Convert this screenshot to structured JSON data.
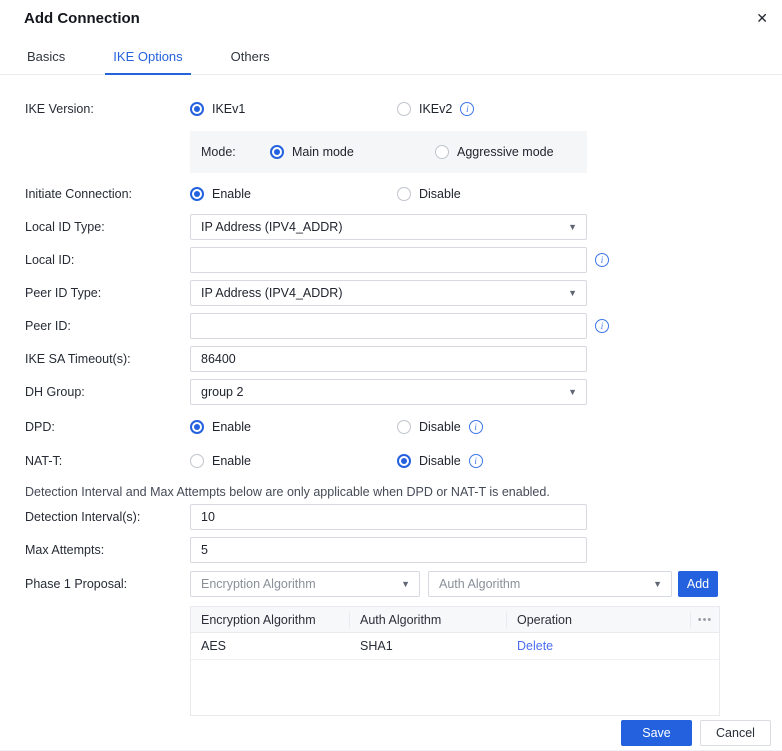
{
  "header": {
    "title": "Add Connection",
    "close_icon": "✕"
  },
  "tabs": {
    "basics": "Basics",
    "ike_options": "IKE Options",
    "others": "Others"
  },
  "rows": {
    "ike_version": {
      "label": "IKE Version:",
      "opt1": "IKEv1",
      "opt2": "IKEv2"
    },
    "mode": {
      "label": "Mode:",
      "opt1": "Main mode",
      "opt2": "Aggressive mode"
    },
    "initiate_connection": {
      "label": "Initiate Connection:",
      "opt1": "Enable",
      "opt2": "Disable"
    },
    "local_id_type": {
      "label": "Local ID Type:",
      "value": "IP Address (IPV4_ADDR)"
    },
    "local_id": {
      "label": "Local ID:",
      "value": ""
    },
    "peer_id_type": {
      "label": "Peer ID Type:",
      "value": "IP Address (IPV4_ADDR)"
    },
    "peer_id": {
      "label": "Peer ID:",
      "value": ""
    },
    "ike_sa_timeout": {
      "label": "IKE SA Timeout(s):",
      "value": "86400"
    },
    "dh_group": {
      "label": "DH Group:",
      "value": "group 2"
    },
    "dpd": {
      "label": "DPD:",
      "opt1": "Enable",
      "opt2": "Disable"
    },
    "nat_t": {
      "label": "NAT-T:",
      "opt1": "Enable",
      "opt2": "Disable"
    },
    "note": "Detection Interval and Max Attempts below are only applicable when DPD or NAT-T is enabled.",
    "detection_interval": {
      "label": "Detection Interval(s):",
      "value": "10"
    },
    "max_attempts": {
      "label": "Max Attempts:",
      "value": "5"
    },
    "phase1_proposal": {
      "label": "Phase 1 Proposal:",
      "enc_placeholder": "Encryption Algorithm",
      "auth_placeholder": "Auth Algorithm",
      "add_label": "Add"
    }
  },
  "icons": {
    "info": "i",
    "caret": "▼",
    "more": "•••"
  },
  "table": {
    "headers": {
      "encryption": "Encryption Algorithm",
      "auth": "Auth Algorithm",
      "operation": "Operation"
    },
    "rows": [
      {
        "encryption": "AES",
        "auth": "SHA1",
        "operation": "Delete"
      }
    ]
  },
  "footer": {
    "save": "Save",
    "cancel": "Cancel"
  },
  "colors": {
    "primary": "#2361df",
    "link": "#4e6ef2",
    "tab_active": "#2563db"
  }
}
